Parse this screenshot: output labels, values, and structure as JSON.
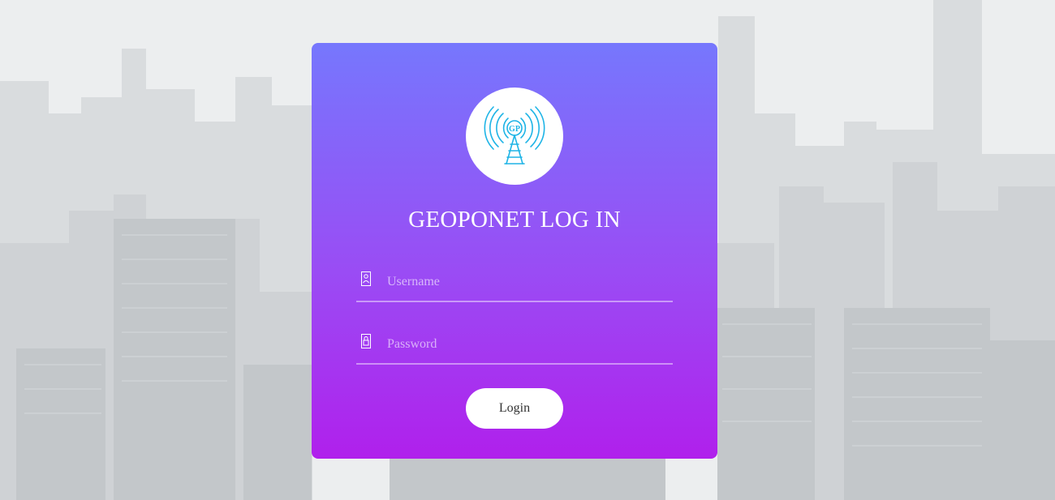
{
  "login_card": {
    "title": "GEOPONET LOG IN",
    "username": {
      "placeholder": "Username",
      "value": ""
    },
    "password": {
      "placeholder": "Password",
      "value": ""
    },
    "login_label": "Login"
  },
  "icons": {
    "logo": "radio-tower-icon",
    "username_field": "user-icon",
    "password_field": "lock-icon"
  },
  "colors": {
    "card_gradient_top": "#7677fd",
    "card_gradient_bottom": "#b020ec",
    "logo_accent": "#1eb4e6",
    "background": "#eceeef"
  }
}
